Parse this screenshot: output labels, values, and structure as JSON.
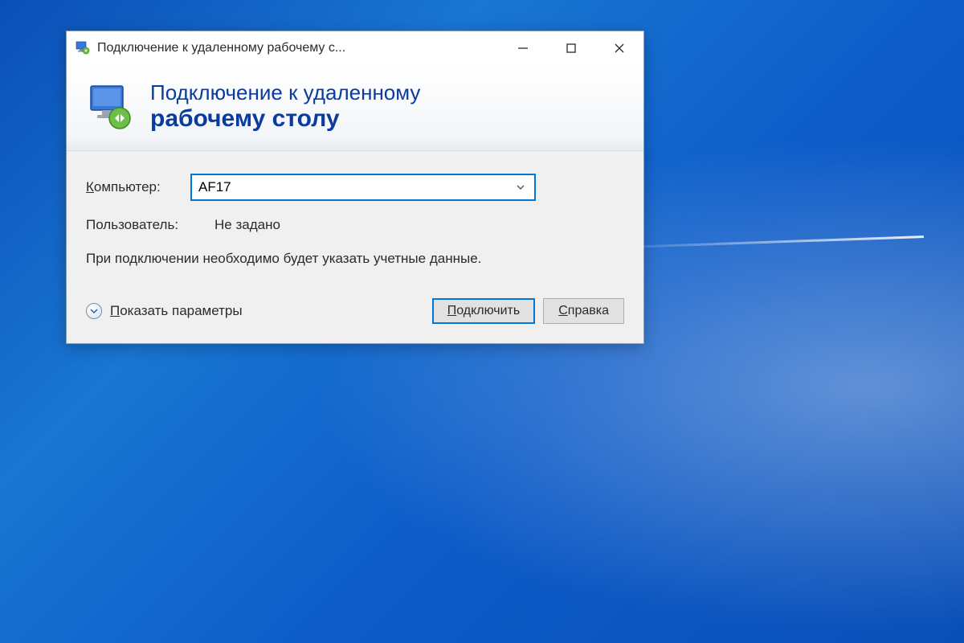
{
  "window": {
    "title": "Подключение к удаленному рабочему с..."
  },
  "banner": {
    "line1": "Подключение к удаленному",
    "line2": "рабочему столу"
  },
  "form": {
    "computer_label": "Компьютер:",
    "computer_value": "AF17",
    "user_label": "Пользователь:",
    "user_value": "Не задано",
    "hint": "При подключении необходимо будет указать учетные данные."
  },
  "footer": {
    "show_options": "Показать параметры",
    "connect": "Подключить",
    "help": "Справка"
  }
}
